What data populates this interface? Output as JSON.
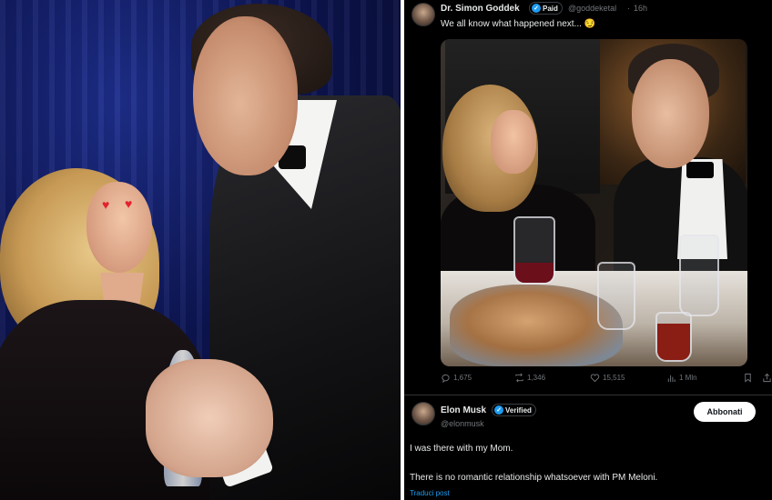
{
  "left_photo": {
    "alt_heart_icons": [
      "heart-icon",
      "heart-icon"
    ]
  },
  "tweet1": {
    "author_name": "Dr. Simon Goddek",
    "badge_label": "Paid",
    "handle": "@goddeketal",
    "separator": "·",
    "time": "16h",
    "text": "We all know what happened next... 😏",
    "stats": {
      "replies": "1,675",
      "reposts": "1,346",
      "likes": "15,515",
      "views": "1 Mln"
    }
  },
  "tweet2": {
    "author_name": "Elon Musk",
    "badge_label": "Verified",
    "handle": "@elonmusk",
    "follow_label": "Abbonati",
    "line1": "I was there with my Mom.",
    "line2": "There is no romantic relationship whatsoever with PM Meloni.",
    "translate_label": "Traduci post"
  },
  "colors": {
    "accent": "#1d9bf0",
    "background": "#000000",
    "text": "#e7e9ea",
    "muted": "#71767b"
  }
}
